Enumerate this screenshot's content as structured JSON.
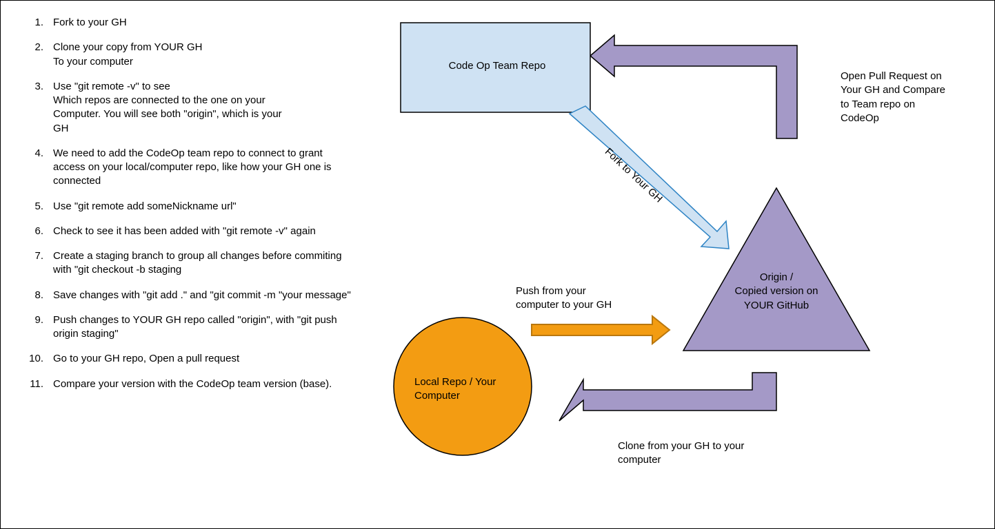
{
  "steps": [
    "Fork to your GH",
    "Clone your copy from YOUR GH\nTo your computer",
    "Use \"git remote -v\" to see\nWhich repos are connected to the one on your\nComputer. You will see both \"origin\", which is your\nGH",
    "We need to add the CodeOp team repo to connect to grant access on your local/computer repo, like how your GH one is connected",
    "Use \"git remote add someNickname url\"",
    "Check to see it has been added with \"git remote -v\" again",
    "Create a staging branch to group all changes before commiting with \"git checkout -b staging",
    "Save changes with \"git add .\" and \"git commit -m \"your message\"",
    "Push changes to YOUR GH repo called \"origin\", with \"git push origin staging\"",
    "Go to your GH repo, Open a pull request",
    "Compare your version with the CodeOp team version (base)."
  ],
  "diagram": {
    "box_label": "Code Op Team Repo",
    "triangle_label_1": "Origin /",
    "triangle_label_2": "Copied version on",
    "triangle_label_3": "YOUR GitHub",
    "circle_label_1": "Local Repo / Your",
    "circle_label_2": "Computer",
    "fork_label": "Fork to Your GH",
    "push_label_1": "Push from your",
    "push_label_2": "computer to your GH",
    "clone_label_1": "Clone from your GH to your",
    "clone_label_2": "computer",
    "pr_label_1": "Open Pull Request on",
    "pr_label_2": "Your GH and Compare",
    "pr_label_3": "to Team repo on",
    "pr_label_4": "CodeOp",
    "colors": {
      "box_fill": "#cfe2f3",
      "box_stroke": "#000000",
      "triangle_fill": "#a499c7",
      "triangle_stroke": "#000000",
      "circle_fill": "#f39c12",
      "circle_stroke": "#000000",
      "fork_arrow_fill": "#cfe2f3",
      "fork_arrow_stroke": "#2d83c4",
      "push_arrow_fill": "#f39c12",
      "push_arrow_stroke": "#b9770e",
      "big_arrow_fill": "#a499c7",
      "big_arrow_stroke": "#000000"
    }
  }
}
